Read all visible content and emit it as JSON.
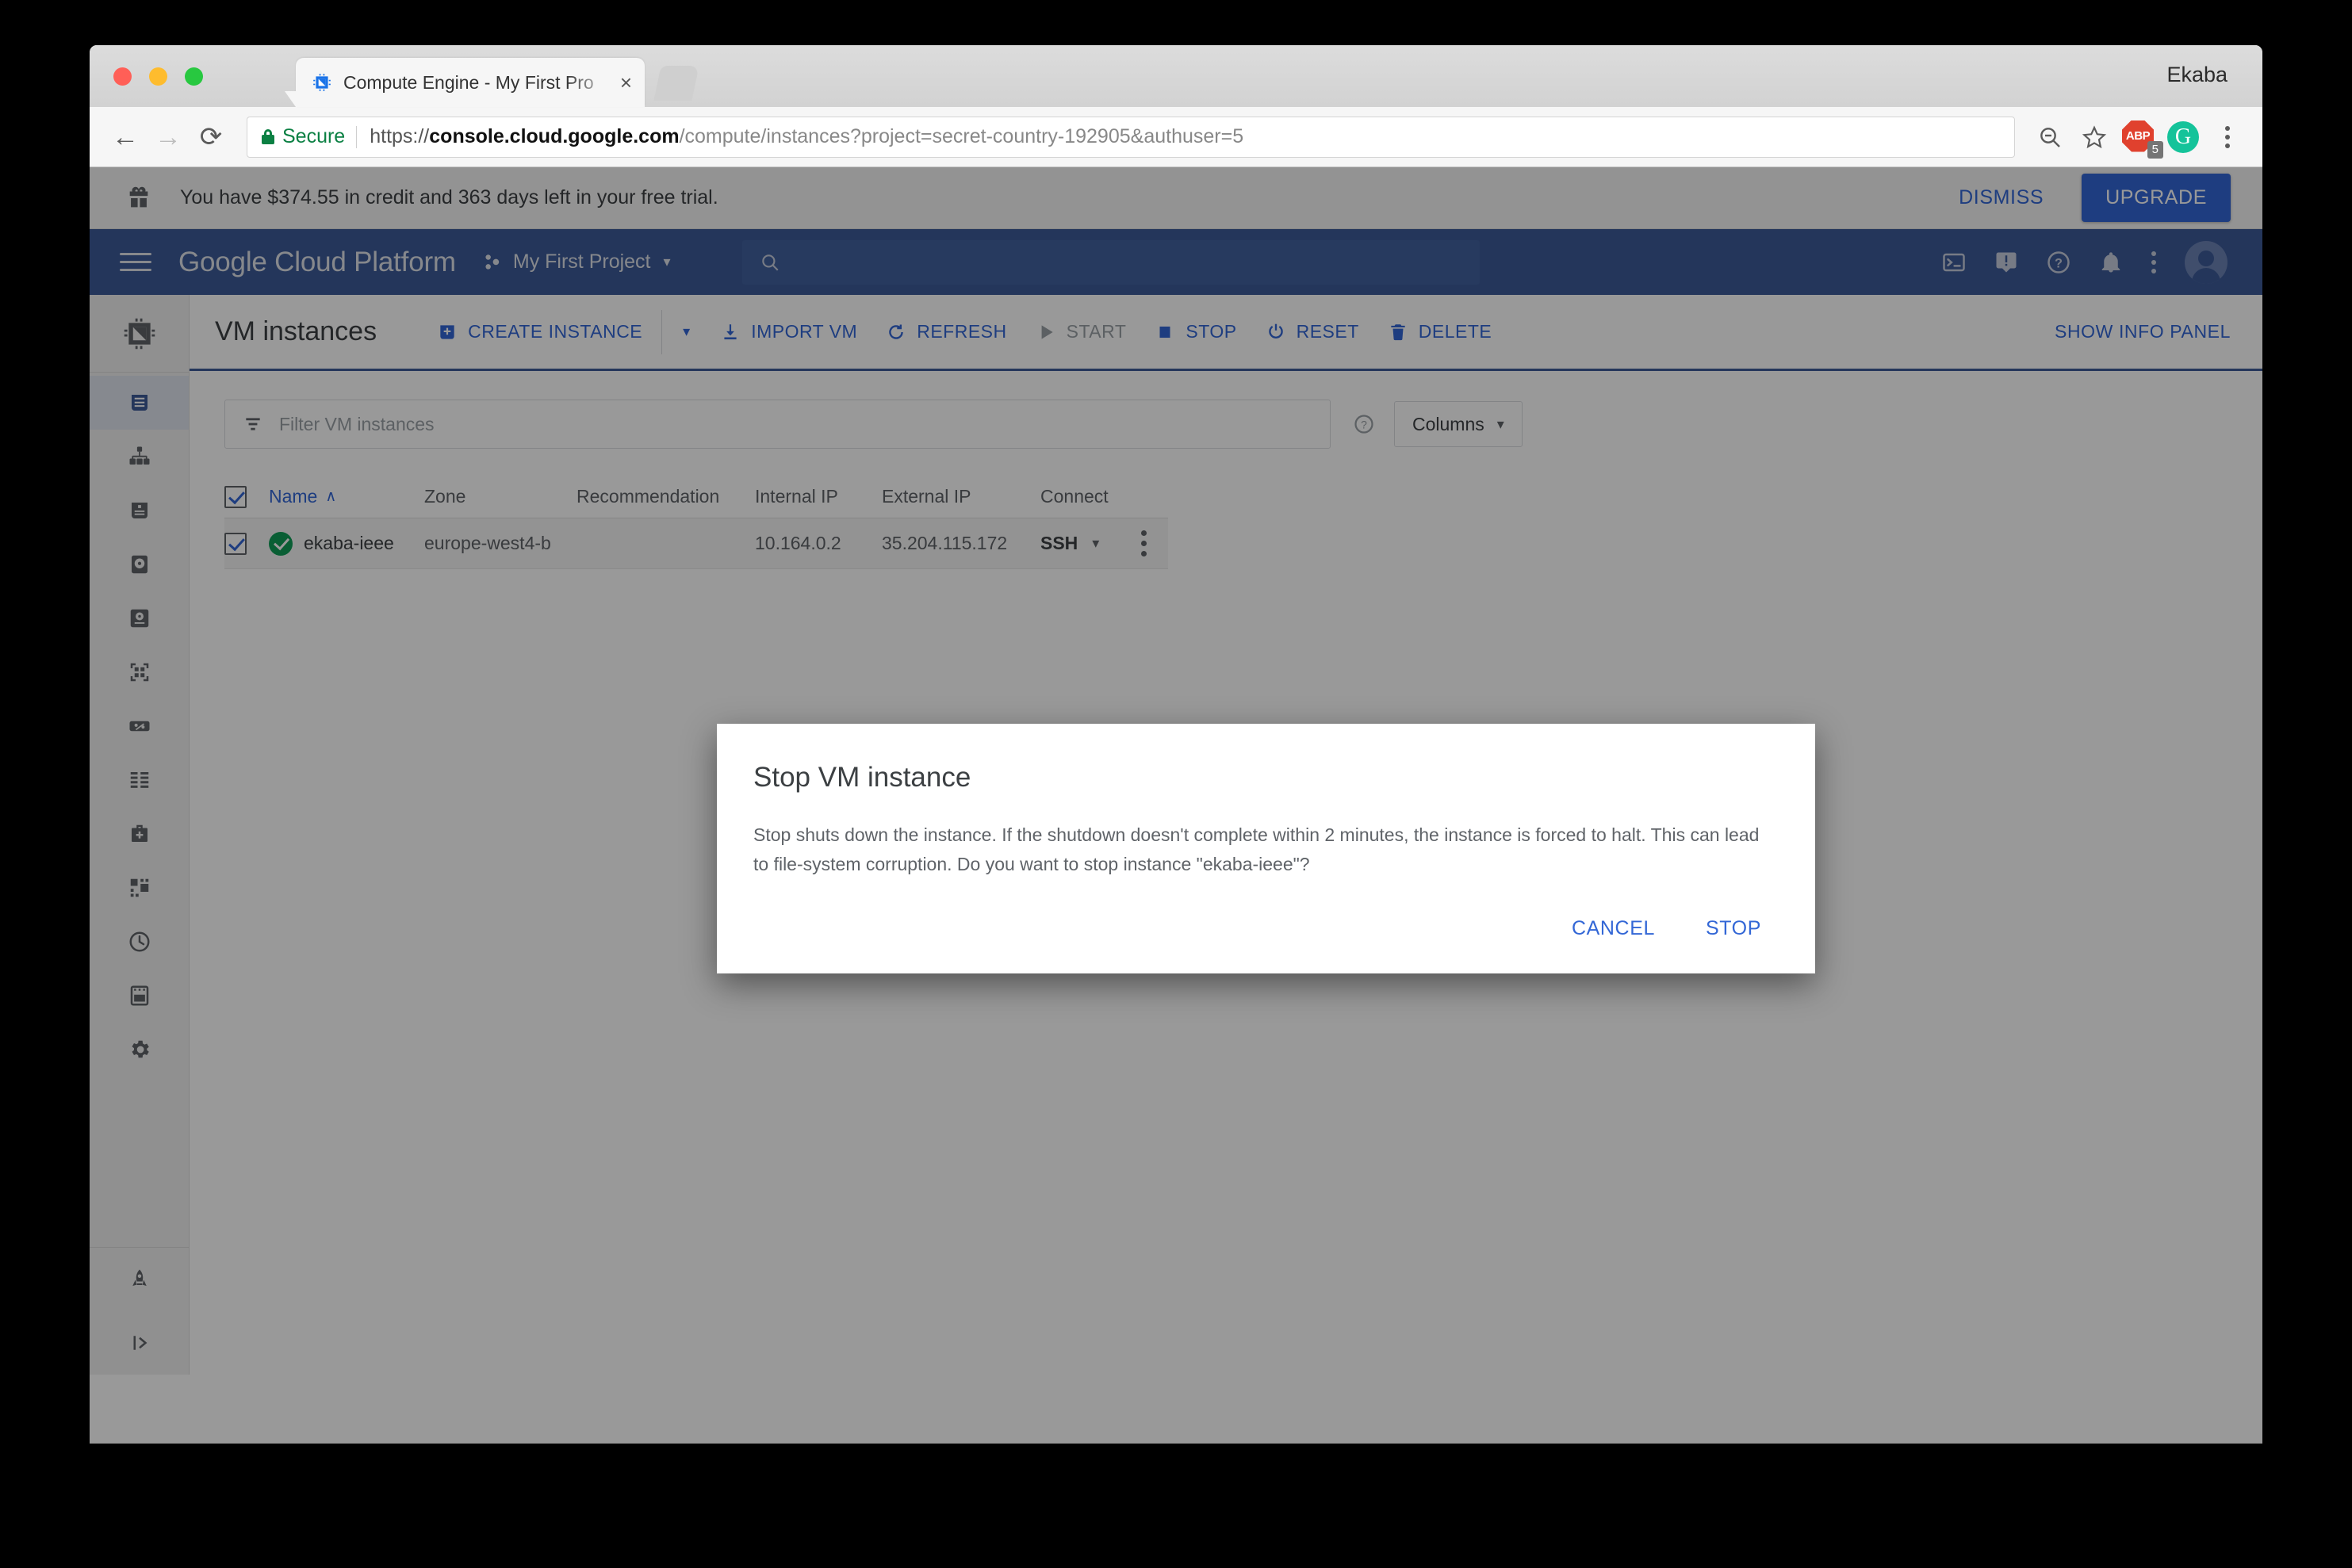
{
  "browser": {
    "profile_name": "Ekaba",
    "tab": {
      "title": "Compute Engine - My First Pro",
      "close_label": "×",
      "favicon_name": "cpu-chip-favicon"
    },
    "omnibox": {
      "secure_label": "Secure",
      "url_scheme": "https://",
      "url_host": "console.cloud.google.com",
      "url_path": "/compute/instances?project=secret-country-192905&authuser=5",
      "full_url": "https://console.cloud.google.com/compute/instances?project=secret-country-192905&authuser=5"
    },
    "extensions": {
      "adblock_label": "ABP",
      "adblock_badge": "5",
      "grammarly_label": "G"
    },
    "nav": {
      "back": "←",
      "forward": "→",
      "reload": "⟳"
    }
  },
  "trial_banner": {
    "message": "You have $374.55 in credit and 363 days left in your free trial.",
    "credit": "$374.55",
    "days_left": "363",
    "dismiss_label": "DISMISS",
    "upgrade_label": "UPGRADE"
  },
  "gcp_header": {
    "logo_text": "Google Cloud Platform",
    "project_name": "My First Project",
    "project_caret": "▾",
    "search_placeholder": "",
    "icons": [
      "cloud-shell-icon",
      "feedback-icon",
      "help-icon",
      "notifications-icon",
      "more-vert-icon",
      "account-avatar"
    ]
  },
  "vm_toolbar": {
    "page_title": "VM instances",
    "create_instance": "CREATE INSTANCE",
    "create_caret": "▾",
    "import_vm": "IMPORT VM",
    "refresh": "REFRESH",
    "start": "START",
    "stop": "STOP",
    "reset": "RESET",
    "delete": "DELETE",
    "show_info_panel": "SHOW INFO PANEL"
  },
  "filter": {
    "placeholder": "Filter VM instances",
    "columns_label": "Columns",
    "columns_caret": "▾"
  },
  "table": {
    "headers": [
      "Name",
      "Zone",
      "Recommendation",
      "Internal IP",
      "External IP",
      "Connect"
    ],
    "sort_column": "Name",
    "sort_arrow": "∧",
    "header_checked": true,
    "rows": [
      {
        "checked": true,
        "status": "running",
        "name": "ekaba-ieee",
        "zone": "europe-west4-b",
        "recommendation": "",
        "internal_ip": "10.164.0.2",
        "external_ip": "35.204.115.172",
        "connect": "SSH",
        "connect_caret": "▾"
      }
    ]
  },
  "sidebar": {
    "product_logo": "compute-engine-icon",
    "items": [
      {
        "name": "vm-instances",
        "active": true
      },
      {
        "name": "instance-groups",
        "active": false
      },
      {
        "name": "instance-templates",
        "active": false
      },
      {
        "name": "disks",
        "active": false
      },
      {
        "name": "snapshots",
        "active": false
      },
      {
        "name": "images",
        "active": false
      },
      {
        "name": "committed-use-discounts",
        "active": false
      },
      {
        "name": "metadata",
        "active": false
      },
      {
        "name": "health-checks",
        "active": false
      },
      {
        "name": "zones",
        "active": false
      },
      {
        "name": "operations",
        "active": false
      },
      {
        "name": "quotas",
        "active": false
      },
      {
        "name": "settings",
        "active": false
      }
    ],
    "bottom_items": [
      {
        "name": "marketplace"
      },
      {
        "name": "expand-panel"
      }
    ]
  },
  "dialog": {
    "title": "Stop VM instance",
    "body": "Stop shuts down the instance. If the shutdown doesn't complete within 2 minutes, the instance is forced to halt. This can lead to file-system corruption. Do you want to stop instance \"ekaba-ieee\"?",
    "cancel_label": "CANCEL",
    "confirm_label": "STOP"
  },
  "colors": {
    "gcp_blue": "#3c5a98",
    "link_blue": "#3367d6",
    "dialog_action_blue": "#3367d6",
    "secure_green": "#0b8043",
    "status_green": "#0f9d58",
    "upgrade_bg": "#3367d6"
  }
}
